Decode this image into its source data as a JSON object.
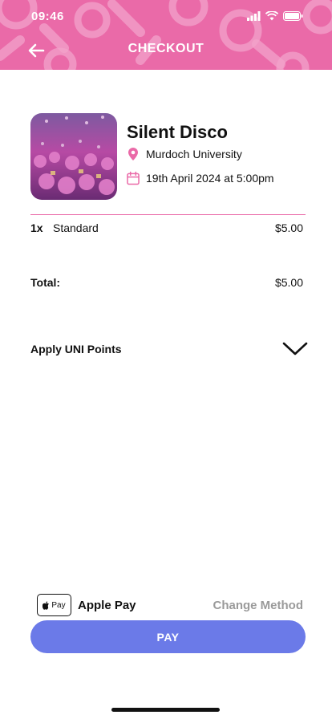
{
  "status_bar": {
    "time": "09:46"
  },
  "header": {
    "title": "CHECKOUT",
    "back_icon": "arrow-left-icon"
  },
  "event": {
    "title": "Silent Disco",
    "location": "Murdoch University",
    "datetime": "19th April 2024 at 5:00pm",
    "location_icon": "map-pin-icon",
    "date_icon": "calendar-icon"
  },
  "order": {
    "items": [
      {
        "qty": "1x",
        "name": "Standard",
        "price": "$5.00"
      }
    ],
    "total_label": "Total:",
    "total_value": "$5.00"
  },
  "points": {
    "label": "Apply UNI Points",
    "icon": "chevron-down-icon"
  },
  "payment": {
    "badge_label": "Pay",
    "method": "Apple Pay",
    "change_label": "Change Method",
    "pay_label": "PAY"
  },
  "colors": {
    "brand_pink": "#ea6aa8",
    "pay_blue": "#6b7ae8",
    "muted_gray": "#9a9a9a"
  }
}
